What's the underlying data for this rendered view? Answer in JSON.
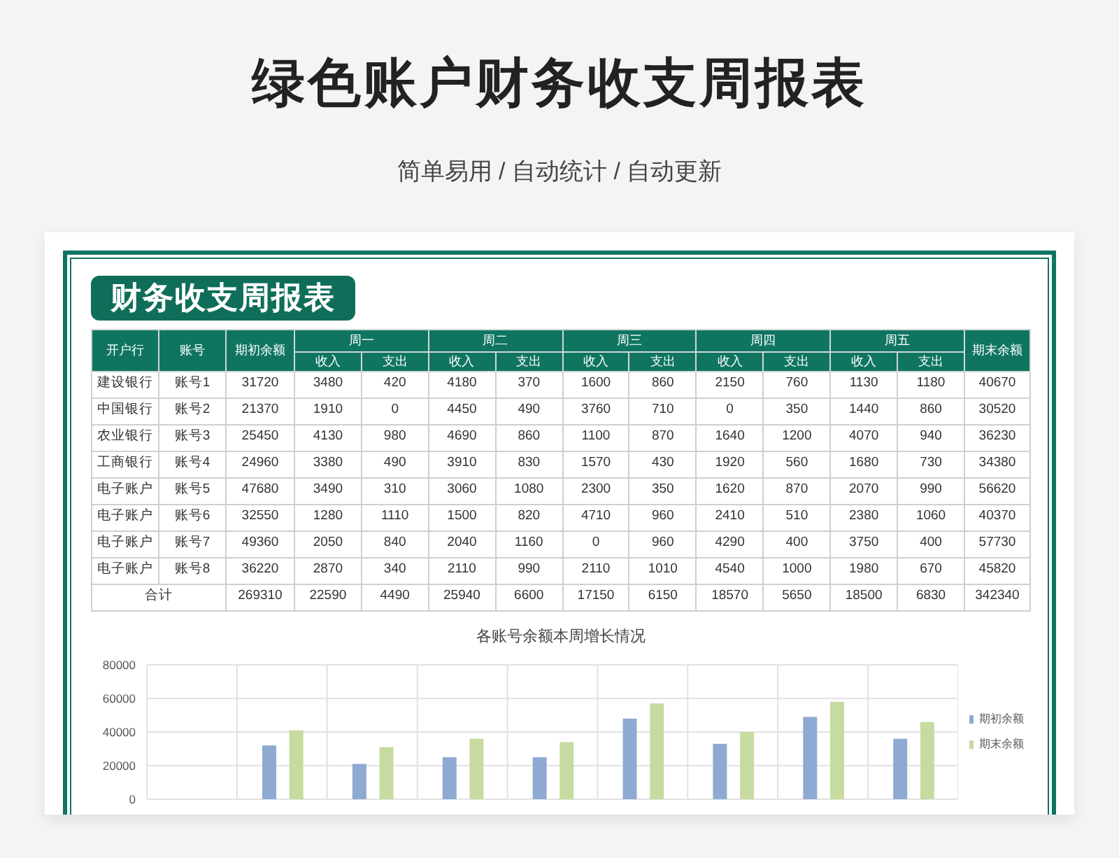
{
  "title": "绿色账户财务收支周报表",
  "subtitle": "简单易用 / 自动统计 / 自动更新",
  "report": {
    "banner": "财务收支周报表",
    "columns": {
      "bank": "开户行",
      "account": "账号",
      "opening": "期初余额",
      "closing": "期末余额",
      "days": [
        {
          "name": "周一",
          "income": "收入",
          "expense": "支出"
        },
        {
          "name": "周二",
          "income": "收入",
          "expense": "支出"
        },
        {
          "name": "周三",
          "income": "收入",
          "expense": "支出"
        },
        {
          "name": "周四",
          "income": "收入",
          "expense": "支出"
        },
        {
          "name": "周五",
          "income": "收入",
          "expense": "支出"
        }
      ]
    },
    "rows": [
      [
        "建设银行",
        "账号1",
        "31720",
        "3480",
        "420",
        "4180",
        "370",
        "1600",
        "860",
        "2150",
        "760",
        "1130",
        "1180",
        "40670"
      ],
      [
        "中国银行",
        "账号2",
        "21370",
        "1910",
        "0",
        "4450",
        "490",
        "3760",
        "710",
        "0",
        "350",
        "1440",
        "860",
        "30520"
      ],
      [
        "农业银行",
        "账号3",
        "25450",
        "4130",
        "980",
        "4690",
        "860",
        "1100",
        "870",
        "1640",
        "1200",
        "4070",
        "940",
        "36230"
      ],
      [
        "工商银行",
        "账号4",
        "24960",
        "3380",
        "490",
        "3910",
        "830",
        "1570",
        "430",
        "1920",
        "560",
        "1680",
        "730",
        "34380"
      ],
      [
        "电子账户",
        "账号5",
        "47680",
        "3490",
        "310",
        "3060",
        "1080",
        "2300",
        "350",
        "1620",
        "870",
        "2070",
        "990",
        "56620"
      ],
      [
        "电子账户",
        "账号6",
        "32550",
        "1280",
        "1110",
        "1500",
        "820",
        "4710",
        "960",
        "2410",
        "510",
        "2380",
        "1060",
        "40370"
      ],
      [
        "电子账户",
        "账号7",
        "49360",
        "2050",
        "840",
        "2040",
        "1160",
        "0",
        "960",
        "4290",
        "400",
        "3750",
        "400",
        "57730"
      ],
      [
        "电子账户",
        "账号8",
        "36220",
        "2870",
        "340",
        "2110",
        "990",
        "2110",
        "1010",
        "4540",
        "1000",
        "1980",
        "670",
        "45820"
      ]
    ],
    "total": {
      "label": "合计",
      "values": [
        "269310",
        "22590",
        "4490",
        "25940",
        "6600",
        "17150",
        "6150",
        "18570",
        "5650",
        "18500",
        "6830",
        "342340"
      ]
    }
  },
  "chart": {
    "chart_data": {
      "type": "bar",
      "grid": true,
      "title": "各账号余额本周增长情况",
      "ylim": [
        0,
        80000
      ],
      "yticks": [
        0,
        20000,
        40000,
        60000,
        80000
      ],
      "series": [
        {
          "name": "期初余额",
          "color": "#8eaad3",
          "values": [
            null,
            32000,
            21000,
            25000,
            25000,
            48000,
            33000,
            49000,
            36000
          ]
        },
        {
          "name": "期末余额",
          "color": "#c7dba0",
          "values": [
            null,
            41000,
            31000,
            36000,
            34000,
            57000,
            40000,
            58000,
            46000
          ]
        }
      ]
    }
  }
}
